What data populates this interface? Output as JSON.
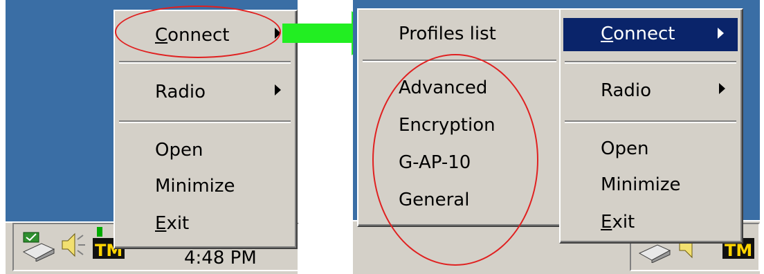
{
  "left": {
    "menu": {
      "connect": {
        "accel": "C",
        "rest": "onnect"
      },
      "radio": "Radio",
      "open": "Open",
      "minimize": "Minimize",
      "exit": {
        "accel": "E",
        "rest": "xit"
      }
    },
    "tray": {
      "clock": "4:48 PM"
    }
  },
  "right": {
    "submenu": {
      "profiles_list": "Profiles list",
      "profiles": [
        "Advanced",
        "Encryption",
        "G-AP-10",
        "General"
      ]
    },
    "menu": {
      "connect": {
        "accel": "C",
        "rest": "onnect"
      },
      "radio": "Radio",
      "open": "Open",
      "minimize": "Minimize",
      "exit": {
        "accel": "E",
        "rest": "xit"
      }
    }
  },
  "colors": {
    "desktop": "#3a6ea5",
    "menu": "#d4d0c8",
    "highlight": "#0a246a",
    "annotation_red": "#e02020",
    "annotation_green": "#22ee22"
  },
  "icons": [
    "network-connection-icon",
    "speaker-icon",
    "wireless-utility-tm-icon",
    "submenu-arrow-icon",
    "callout-arrow-icon"
  ]
}
